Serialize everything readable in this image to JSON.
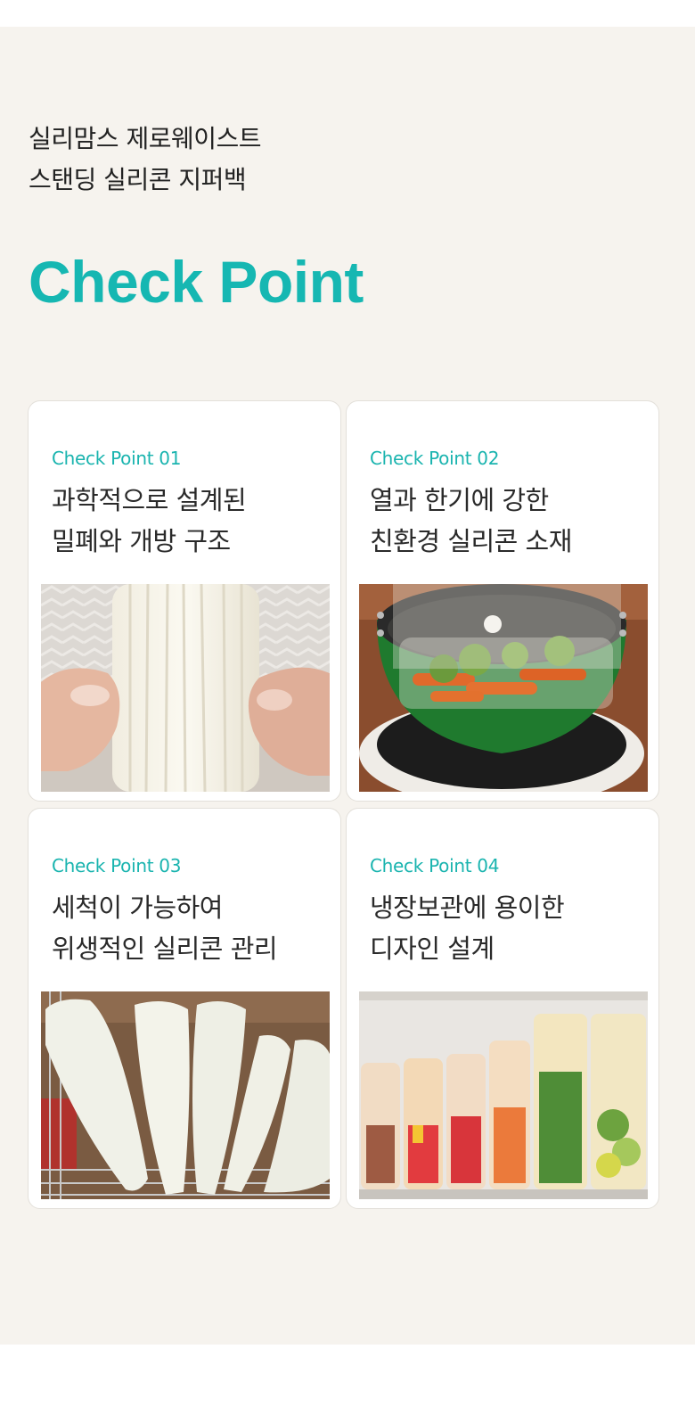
{
  "header": {
    "subtitle": "실리맘스 제로웨이스트\n스탠딩 실리콘 지퍼백",
    "title": "Check Point"
  },
  "cards": [
    {
      "tag": "Check Point 01",
      "text": "과학적으로 설계된\n밀폐와 개방 구조",
      "image": "hands-opening-silicone-bag"
    },
    {
      "tag": "Check Point 02",
      "text": "열과 한기에 강한\n친환경 실리콘 소재",
      "image": "silicone-lid-on-steaming-pot"
    },
    {
      "tag": "Check Point 03",
      "text": "세척이 가능하여\n위생적인 실리콘 관리",
      "image": "silicone-bags-drying-on-rack"
    },
    {
      "tag": "Check Point 04",
      "text": "냉장보관에 용이한\n디자인 설계",
      "image": "silicone-bags-in-refrigerator"
    }
  ],
  "colors": {
    "accent": "#16b7b2",
    "section_bg": "#f6f3ee",
    "text": "#222222"
  }
}
